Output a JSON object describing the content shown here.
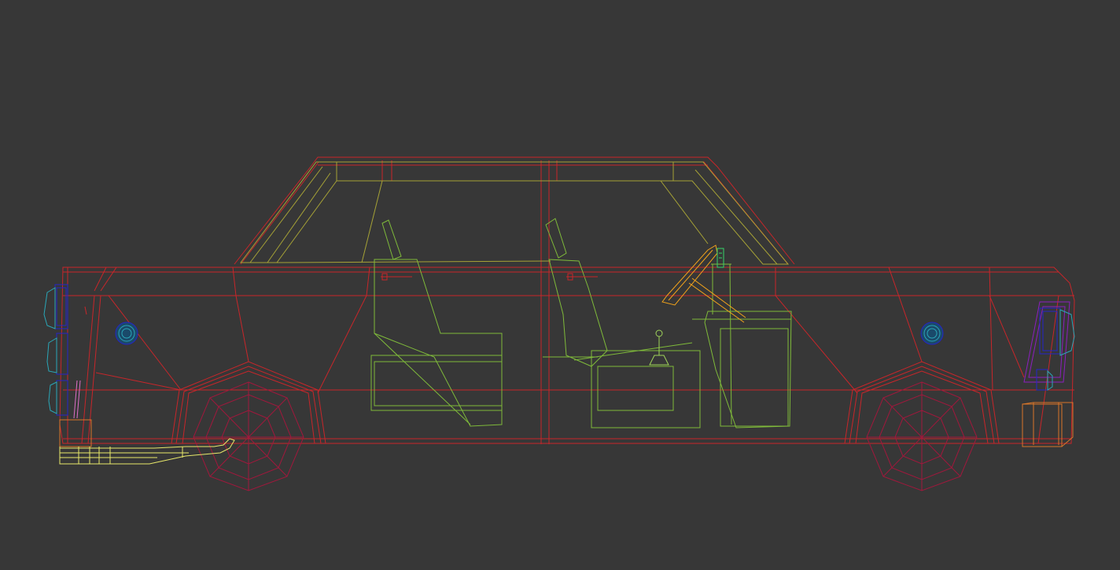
{
  "viewport": {
    "background": "#373737"
  },
  "colors": {
    "body_wire": "#c8262a",
    "interior_wire": "#7fba3a",
    "window_trim_wire": "#a6a236",
    "steering_wire": "#f2a31b",
    "exhaust_wire": "#e8e86a",
    "light_wire": "#2424c8",
    "lens_wire": "#2aa7b8",
    "wheel_wire": "#a0183c"
  }
}
